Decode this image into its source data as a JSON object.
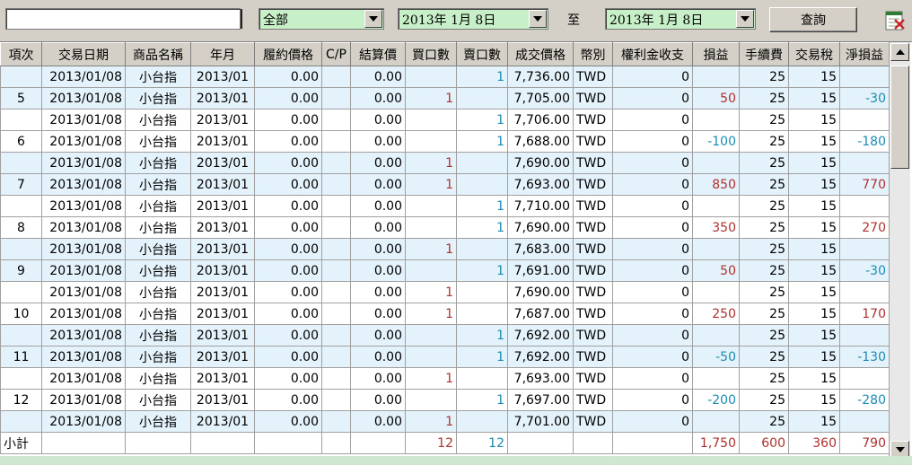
{
  "toolbar": {
    "account_value": "",
    "category_value": "全部",
    "date_from": "2013年  1月  8日",
    "to_label": "至",
    "date_to": "2013年  1月  8日",
    "query_label": "查詢",
    "export_icon": "excel-export-icon"
  },
  "table": {
    "columns": [
      "項次",
      "交易日期",
      "商品名稱",
      "年月",
      "履約價格",
      "C/P",
      "結算價",
      "買口數",
      "賣口數",
      "成交價格",
      "幣別",
      "權利金收支",
      "損益",
      "手續費",
      "交易稅",
      "淨損益"
    ],
    "rows": [
      {
        "no": "",
        "date": "2013/01/08",
        "product": "小台指",
        "ym": "2013/01",
        "strike": "0.00",
        "cp": "",
        "settle": "0.00",
        "buy": "",
        "sell": "1",
        "price": "7,736.00",
        "cur": "TWD",
        "premium": "0",
        "pl": "",
        "fee": "25",
        "tax": "15",
        "net": ""
      },
      {
        "no": "5",
        "date": "2013/01/08",
        "product": "小台指",
        "ym": "2013/01",
        "strike": "0.00",
        "cp": "",
        "settle": "0.00",
        "buy": "1",
        "sell": "",
        "price": "7,705.00",
        "cur": "TWD",
        "premium": "0",
        "pl": "50",
        "fee": "25",
        "tax": "15",
        "net": "-30"
      },
      {
        "no": "",
        "date": "2013/01/08",
        "product": "小台指",
        "ym": "2013/01",
        "strike": "0.00",
        "cp": "",
        "settle": "0.00",
        "buy": "",
        "sell": "1",
        "price": "7,706.00",
        "cur": "TWD",
        "premium": "0",
        "pl": "",
        "fee": "25",
        "tax": "15",
        "net": ""
      },
      {
        "no": "6",
        "date": "2013/01/08",
        "product": "小台指",
        "ym": "2013/01",
        "strike": "0.00",
        "cp": "",
        "settle": "0.00",
        "buy": "",
        "sell": "1",
        "price": "7,688.00",
        "cur": "TWD",
        "premium": "0",
        "pl": "-100",
        "fee": "25",
        "tax": "15",
        "net": "-180"
      },
      {
        "no": "",
        "date": "2013/01/08",
        "product": "小台指",
        "ym": "2013/01",
        "strike": "0.00",
        "cp": "",
        "settle": "0.00",
        "buy": "1",
        "sell": "",
        "price": "7,690.00",
        "cur": "TWD",
        "premium": "0",
        "pl": "",
        "fee": "25",
        "tax": "15",
        "net": ""
      },
      {
        "no": "7",
        "date": "2013/01/08",
        "product": "小台指",
        "ym": "2013/01",
        "strike": "0.00",
        "cp": "",
        "settle": "0.00",
        "buy": "1",
        "sell": "",
        "price": "7,693.00",
        "cur": "TWD",
        "premium": "0",
        "pl": "850",
        "fee": "25",
        "tax": "15",
        "net": "770"
      },
      {
        "no": "",
        "date": "2013/01/08",
        "product": "小台指",
        "ym": "2013/01",
        "strike": "0.00",
        "cp": "",
        "settle": "0.00",
        "buy": "",
        "sell": "1",
        "price": "7,710.00",
        "cur": "TWD",
        "premium": "0",
        "pl": "",
        "fee": "25",
        "tax": "15",
        "net": ""
      },
      {
        "no": "8",
        "date": "2013/01/08",
        "product": "小台指",
        "ym": "2013/01",
        "strike": "0.00",
        "cp": "",
        "settle": "0.00",
        "buy": "",
        "sell": "1",
        "price": "7,690.00",
        "cur": "TWD",
        "premium": "0",
        "pl": "350",
        "fee": "25",
        "tax": "15",
        "net": "270"
      },
      {
        "no": "",
        "date": "2013/01/08",
        "product": "小台指",
        "ym": "2013/01",
        "strike": "0.00",
        "cp": "",
        "settle": "0.00",
        "buy": "1",
        "sell": "",
        "price": "7,683.00",
        "cur": "TWD",
        "premium": "0",
        "pl": "",
        "fee": "25",
        "tax": "15",
        "net": ""
      },
      {
        "no": "9",
        "date": "2013/01/08",
        "product": "小台指",
        "ym": "2013/01",
        "strike": "0.00",
        "cp": "",
        "settle": "0.00",
        "buy": "",
        "sell": "1",
        "price": "7,691.00",
        "cur": "TWD",
        "premium": "0",
        "pl": "50",
        "fee": "25",
        "tax": "15",
        "net": "-30"
      },
      {
        "no": "",
        "date": "2013/01/08",
        "product": "小台指",
        "ym": "2013/01",
        "strike": "0.00",
        "cp": "",
        "settle": "0.00",
        "buy": "1",
        "sell": "",
        "price": "7,690.00",
        "cur": "TWD",
        "premium": "0",
        "pl": "",
        "fee": "25",
        "tax": "15",
        "net": ""
      },
      {
        "no": "10",
        "date": "2013/01/08",
        "product": "小台指",
        "ym": "2013/01",
        "strike": "0.00",
        "cp": "",
        "settle": "0.00",
        "buy": "1",
        "sell": "",
        "price": "7,687.00",
        "cur": "TWD",
        "premium": "0",
        "pl": "250",
        "fee": "25",
        "tax": "15",
        "net": "170"
      },
      {
        "no": "",
        "date": "2013/01/08",
        "product": "小台指",
        "ym": "2013/01",
        "strike": "0.00",
        "cp": "",
        "settle": "0.00",
        "buy": "",
        "sell": "1",
        "price": "7,692.00",
        "cur": "TWD",
        "premium": "0",
        "pl": "",
        "fee": "25",
        "tax": "15",
        "net": ""
      },
      {
        "no": "11",
        "date": "2013/01/08",
        "product": "小台指",
        "ym": "2013/01",
        "strike": "0.00",
        "cp": "",
        "settle": "0.00",
        "buy": "",
        "sell": "1",
        "price": "7,692.00",
        "cur": "TWD",
        "premium": "0",
        "pl": "-50",
        "fee": "25",
        "tax": "15",
        "net": "-130"
      },
      {
        "no": "",
        "date": "2013/01/08",
        "product": "小台指",
        "ym": "2013/01",
        "strike": "0.00",
        "cp": "",
        "settle": "0.00",
        "buy": "1",
        "sell": "",
        "price": "7,693.00",
        "cur": "TWD",
        "premium": "0",
        "pl": "",
        "fee": "25",
        "tax": "15",
        "net": ""
      },
      {
        "no": "12",
        "date": "2013/01/08",
        "product": "小台指",
        "ym": "2013/01",
        "strike": "0.00",
        "cp": "",
        "settle": "0.00",
        "buy": "",
        "sell": "1",
        "price": "7,697.00",
        "cur": "TWD",
        "premium": "0",
        "pl": "-200",
        "fee": "25",
        "tax": "15",
        "net": "-280"
      },
      {
        "no": "",
        "date": "2013/01/08",
        "product": "小台指",
        "ym": "2013/01",
        "strike": "0.00",
        "cp": "",
        "settle": "0.00",
        "buy": "1",
        "sell": "",
        "price": "7,701.00",
        "cur": "TWD",
        "premium": "0",
        "pl": "",
        "fee": "25",
        "tax": "15",
        "net": ""
      }
    ],
    "subtotal": {
      "label": "小計",
      "buy": "12",
      "sell": "12",
      "pl": "1,750",
      "fee": "600",
      "tax": "360",
      "net": "790"
    }
  },
  "colors": {
    "positive": "#b03030",
    "negative": "#1a8cb4",
    "alt_row": "#e4f2fb",
    "combo_bg": "#c8f0c8"
  }
}
